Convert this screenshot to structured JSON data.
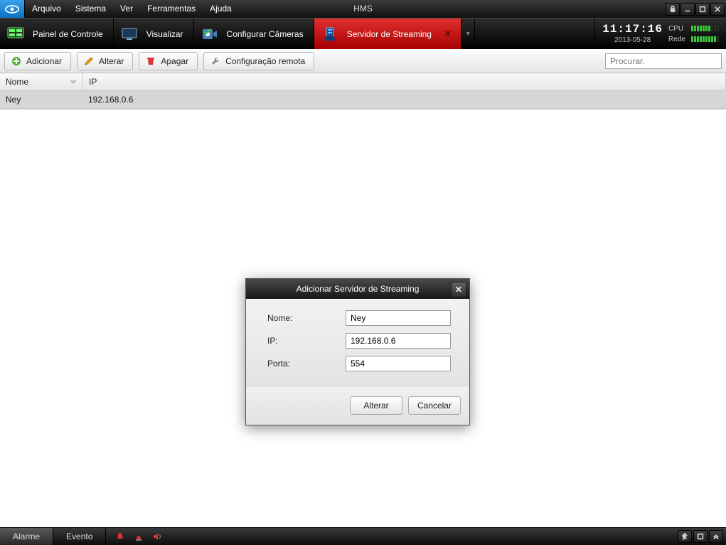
{
  "app": {
    "title": "HMS"
  },
  "menu": {
    "items": [
      "Arquivo",
      "Sistema",
      "Ver",
      "Ferramentas",
      "Ajuda"
    ]
  },
  "tabs": {
    "items": [
      {
        "label": "Painel de Controle"
      },
      {
        "label": "Visualizar"
      },
      {
        "label": "Configurar Câmeras"
      },
      {
        "label": "Servidor de Streaming"
      }
    ],
    "active_index": 3
  },
  "clock": {
    "time": "11:17:16",
    "date": "2013-05-28"
  },
  "meters": {
    "cpu_label": "CPU",
    "net_label": "Rede"
  },
  "toolbar": {
    "add_label": "Adicionar",
    "edit_label": "Alterar",
    "delete_label": "Apagar",
    "remote_label": "Configuração remota",
    "search_placeholder": "Procurar."
  },
  "table": {
    "columns": {
      "name": "Nome",
      "ip": "IP"
    },
    "rows": [
      {
        "name": "Ney",
        "ip": "192.168.0.6"
      }
    ]
  },
  "dialog": {
    "title": "Adicionar Servidor de Streaming",
    "name_label": "Nome:",
    "ip_label": "IP:",
    "port_label": "Porta:",
    "name_value": "Ney",
    "ip_value": "192.168.0.6",
    "port_value": "554",
    "ok_label": "Alterar",
    "cancel_label": "Cancelar"
  },
  "statusbar": {
    "alarm_label": "Alarme",
    "event_label": "Evento"
  }
}
